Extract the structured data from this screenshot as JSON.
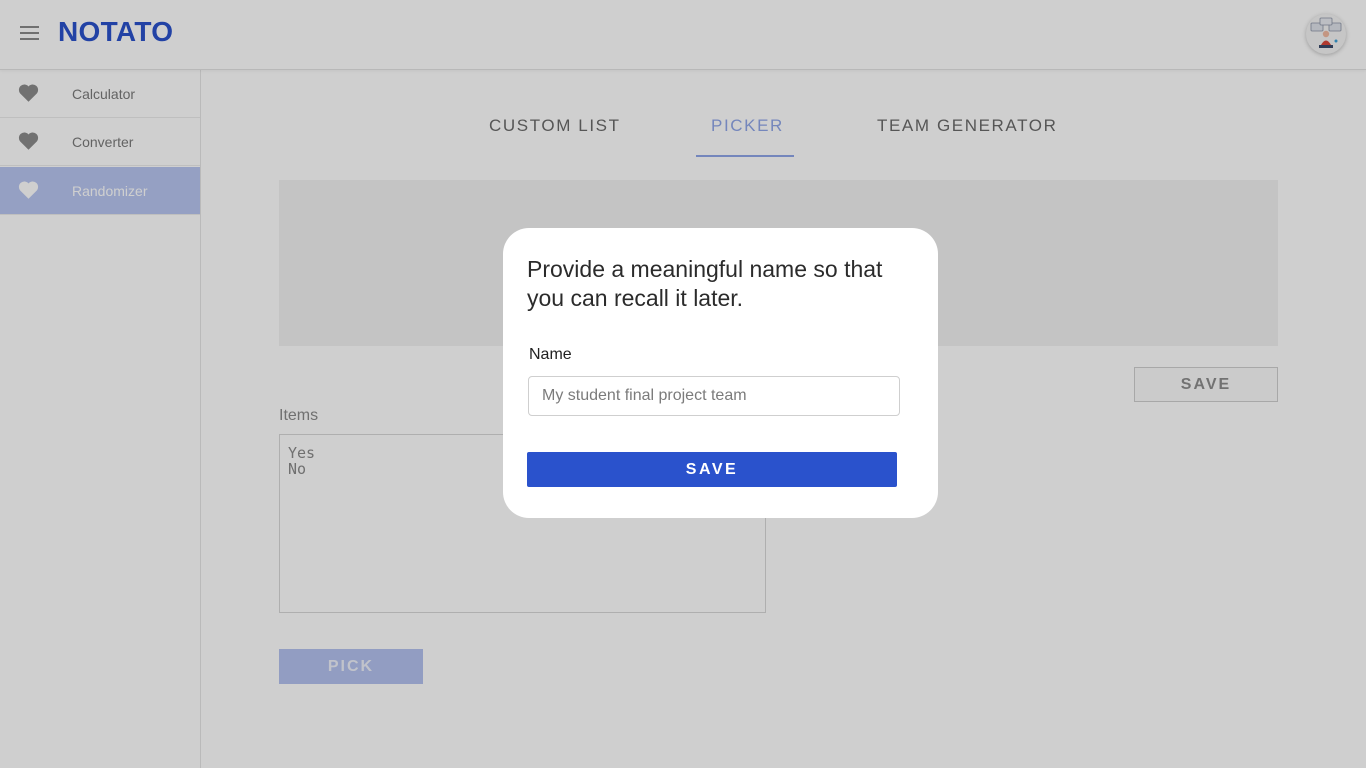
{
  "app": {
    "logo": "NOTATO",
    "brand_color": "#2a52cc",
    "menu_icon": "hamburger-menu-icon",
    "avatar_icon": "user-avatar"
  },
  "sidebar": {
    "items": [
      {
        "label": "Calculator",
        "icon": "heart-icon",
        "active": false
      },
      {
        "label": "Converter",
        "icon": "heart-icon",
        "active": false
      },
      {
        "label": "Randomizer",
        "icon": "heart-icon",
        "active": true
      }
    ]
  },
  "tabs": [
    {
      "label": "CUSTOM LIST",
      "active": false
    },
    {
      "label": "PICKER",
      "active": true
    },
    {
      "label": "TEAM GENERATOR",
      "active": false
    }
  ],
  "picker": {
    "save_label": "SAVE",
    "items_label": "Items",
    "items_value": "Yes\nNo",
    "pick_label": "PICK"
  },
  "modal": {
    "title": "Provide a meaningful name so that you can recall it later.",
    "name_label": "Name",
    "name_value": "",
    "name_placeholder": "My student final project team",
    "save_label": "SAVE"
  },
  "colors": {
    "accent": "#2a52cc",
    "active_sidebar": "#b8c6f0",
    "overlay": "rgba(0,0,0,0.19)"
  }
}
